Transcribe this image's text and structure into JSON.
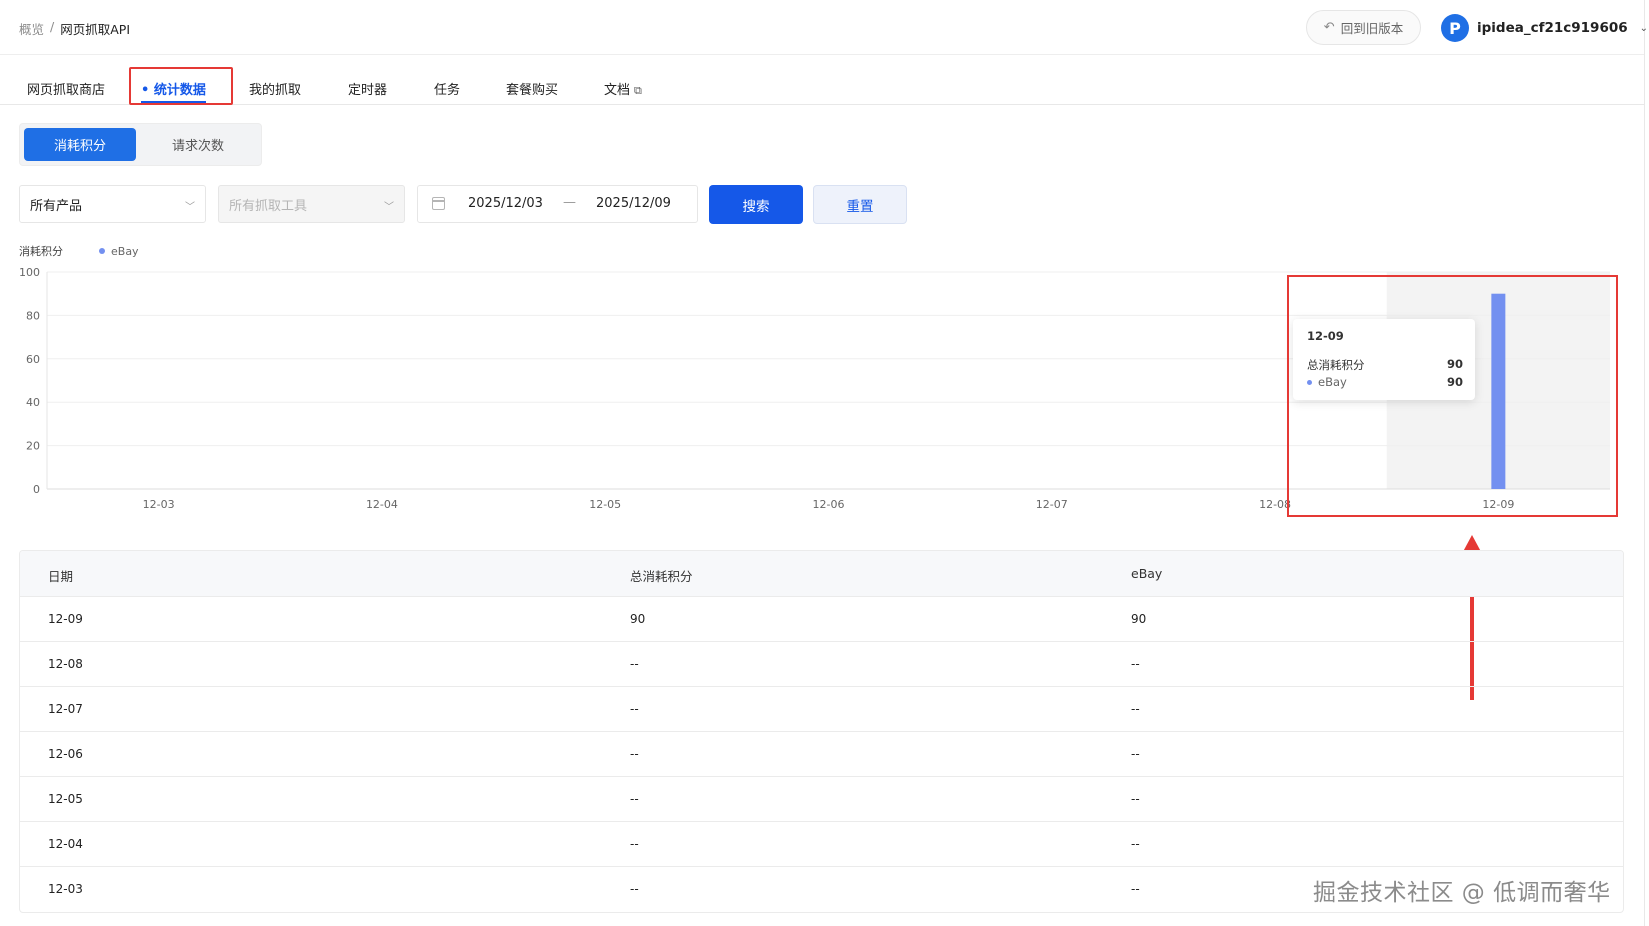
{
  "breadcrumb": {
    "parent": "概览",
    "sep": "/",
    "current": "网页抓取API"
  },
  "header": {
    "old_version": "回到旧版本",
    "user_name": "ipidea_cf21c919606",
    "avatar_letter": "P"
  },
  "tabs": [
    {
      "label": "网页抓取商店"
    },
    {
      "label": "• 统计数据"
    },
    {
      "label": "我的抓取"
    },
    {
      "label": "定时器"
    },
    {
      "label": "任务"
    },
    {
      "label": "套餐购买"
    },
    {
      "label": "文档"
    }
  ],
  "segment": {
    "active": "消耗积分",
    "inactive": "请求次数"
  },
  "filters": {
    "product": "所有产品",
    "tool_placeholder": "所有抓取工具",
    "date_start": "2025/12/03",
    "date_sep": "—",
    "date_end": "2025/12/09",
    "search": "搜索",
    "reset": "重置"
  },
  "chart_data": {
    "type": "bar",
    "ylabel": "消耗积分",
    "categories": [
      "12-03",
      "12-04",
      "12-05",
      "12-06",
      "12-07",
      "12-08",
      "12-09"
    ],
    "series": [
      {
        "name": "eBay",
        "values": [
          0,
          0,
          0,
          0,
          0,
          0,
          90
        ],
        "color": "#7390f0"
      }
    ],
    "ylim": [
      0,
      100
    ],
    "yticks": [
      0,
      20,
      40,
      60,
      80,
      100
    ],
    "grid": true,
    "legend": "top-left",
    "tooltip": {
      "title": "12-09",
      "total_label": "总消耗积分",
      "total_value": "90",
      "series_label": "eBay",
      "series_value": "90"
    }
  },
  "table": {
    "headers": [
      "日期",
      "总消耗积分",
      "eBay"
    ],
    "rows": [
      [
        "12-09",
        "90",
        "90"
      ],
      [
        "12-08",
        "--",
        "--"
      ],
      [
        "12-07",
        "--",
        "--"
      ],
      [
        "12-06",
        "--",
        "--"
      ],
      [
        "12-05",
        "--",
        "--"
      ],
      [
        "12-04",
        "--",
        "--"
      ],
      [
        "12-03",
        "--",
        "--"
      ]
    ]
  },
  "watermark": "掘金技术社区 @ 低调而奢华",
  "colors": {
    "primary": "#1558e8",
    "bar": "#7390f0",
    "annotation": "#e53935"
  }
}
